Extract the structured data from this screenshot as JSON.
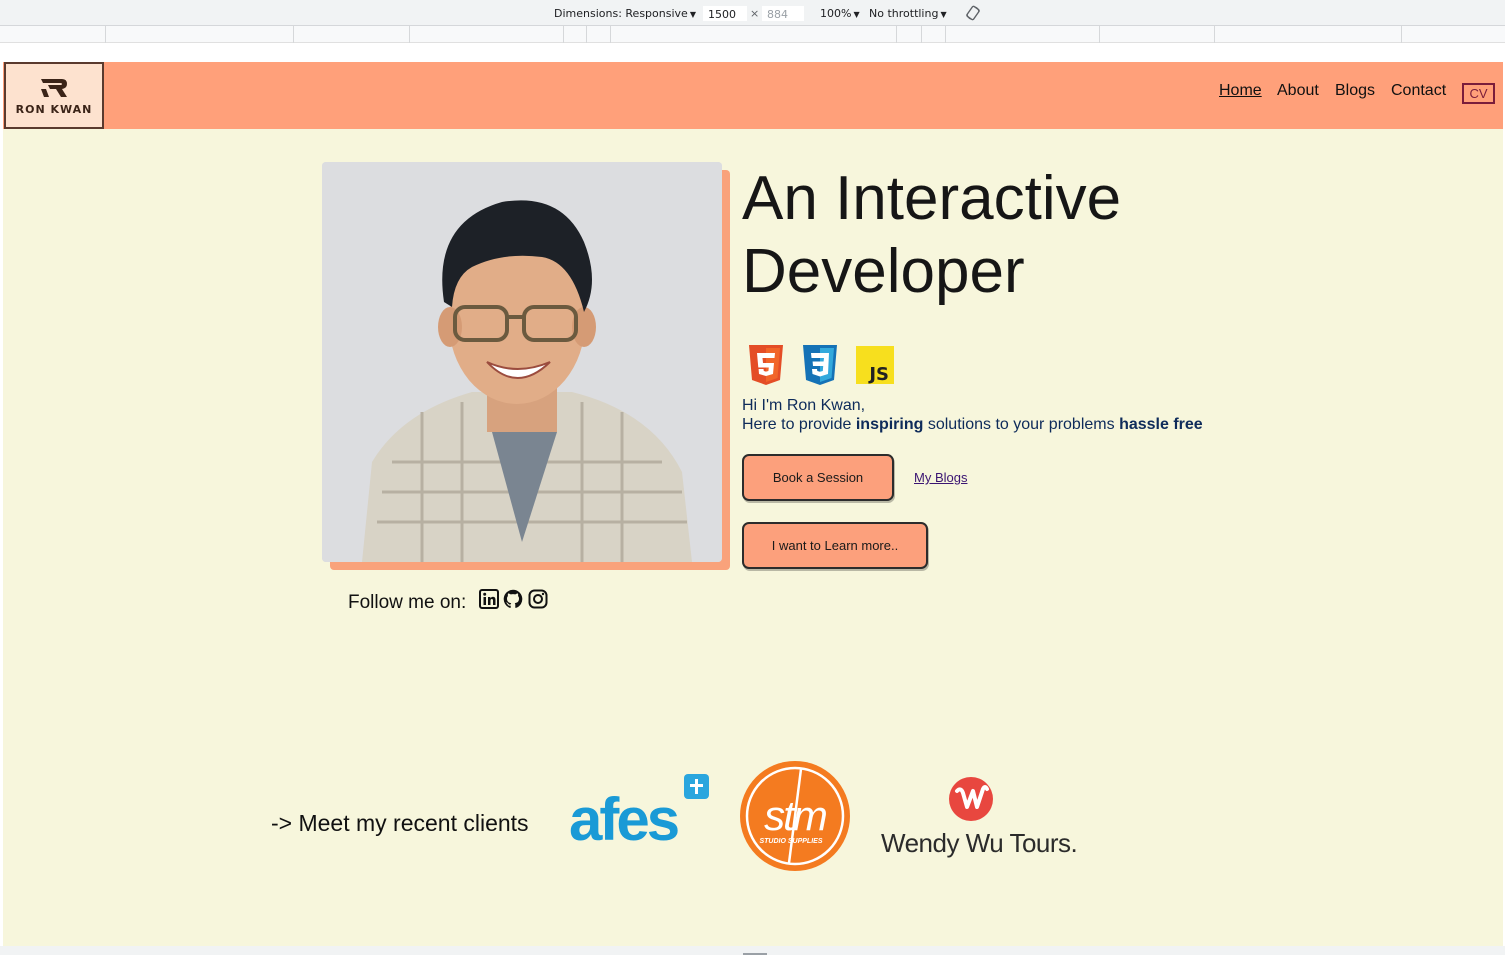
{
  "devtools": {
    "dimensions_label": "Dimensions: Responsive",
    "width": "1500",
    "height": "884",
    "zoom": "100%",
    "throttling": "No throttling",
    "rotate_icon": "rotate-icon"
  },
  "header": {
    "logo_text": "RON KWAN",
    "nav": [
      "Home",
      "About",
      "Blogs",
      "Contact"
    ],
    "active_nav": "Home",
    "cv_label": "CV"
  },
  "hero": {
    "title_line1": "An Interactive",
    "title_line2": "Developer",
    "tech_icons": [
      "html5-icon",
      "css3-icon",
      "javascript-icon"
    ],
    "js_text": "JS",
    "intro_line1": "Hi I'm Ron Kwan,",
    "intro_line2_pre": "Here to provide ",
    "intro_line2_bold1": "inspiring",
    "intro_line2_mid": " solutions to your problems ",
    "intro_line2_bold2": "hassle free",
    "book_button": "Book a Session",
    "blogs_link": "My Blogs",
    "learn_button": "I want to Learn more.."
  },
  "social": {
    "label": "Follow me on:",
    "icons": [
      "linkedin-icon",
      "github-icon",
      "instagram-icon"
    ]
  },
  "clients": {
    "label": "-> Meet my recent clients",
    "logos": [
      {
        "name": "afes",
        "text": "afes"
      },
      {
        "name": "stm",
        "text": "stm",
        "subtext": "STUDIO SUPPLIES"
      },
      {
        "name": "wendy-wu-tours",
        "text": "Wendy Wu Tours."
      }
    ]
  },
  "colors": {
    "header_bg": "#ffa07a",
    "page_bg": "#f7f6dc",
    "button_bg": "#fca07c",
    "stm_orange": "#f47b20",
    "afes_blue": "#1a9ad6",
    "wendy_red": "#e8473f"
  }
}
